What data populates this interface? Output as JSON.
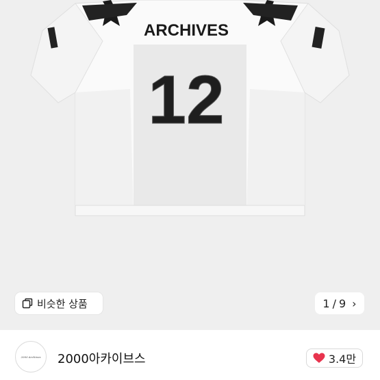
{
  "gallery": {
    "similar_label": "비슷한 상품",
    "counter_current": "1",
    "counter_separator": "/",
    "counter_total": "9",
    "product": {
      "chest_text": "ARCHIVES",
      "number": "12"
    }
  },
  "seller": {
    "avatar_text": "2000 Archives",
    "name": "2000아카이브스"
  },
  "likes": {
    "count": "3.4만",
    "heart_color": "#e8344e"
  },
  "colors": {
    "background": "#efefef",
    "jersey": "#ffffff",
    "accent": "#222222"
  }
}
